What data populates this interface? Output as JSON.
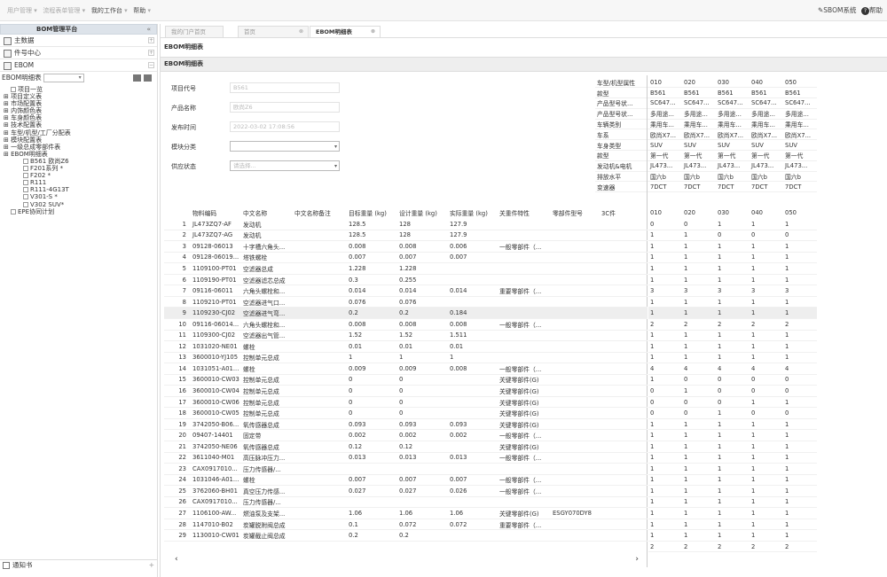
{
  "topbar": {
    "menus": [
      "用户管理",
      "流程表单管理",
      "我的工作台",
      "帮助"
    ],
    "system_label": "SBOM系统",
    "help_label": "帮助"
  },
  "sidebar": {
    "title": "BOM管理平台",
    "sections": [
      "主数据",
      "件号中心",
      "EBOM"
    ],
    "dropdown_value": "EBOM明细表",
    "tree": [
      {
        "label": "项目一览",
        "level": 1,
        "type": "item"
      },
      {
        "label": "项目定义表",
        "level": 0,
        "type": "folder"
      },
      {
        "label": "市场配置表",
        "level": 0,
        "type": "folder"
      },
      {
        "label": "内饰颜色表",
        "level": 0,
        "type": "folder"
      },
      {
        "label": "车身颜色表",
        "level": 0,
        "type": "folder"
      },
      {
        "label": "技术配置表",
        "level": 0,
        "type": "folder"
      },
      {
        "label": "车型/机型/工厂分配表",
        "level": 0,
        "type": "folder"
      },
      {
        "label": "模块配置表",
        "level": 0,
        "type": "folder"
      },
      {
        "label": "一级总成零部件表",
        "level": 0,
        "type": "folder"
      },
      {
        "label": "EBOM明细表",
        "level": 0,
        "type": "folder"
      },
      {
        "label": "B561 欧尚Z6",
        "level": 2,
        "type": "item"
      },
      {
        "label": "F201系列 *",
        "level": 2,
        "type": "item"
      },
      {
        "label": "F202 *",
        "level": 2,
        "type": "item"
      },
      {
        "label": "R111",
        "level": 2,
        "type": "item"
      },
      {
        "label": "R111-4G13T",
        "level": 2,
        "type": "item"
      },
      {
        "label": "V301-S *",
        "level": 2,
        "type": "item"
      },
      {
        "label": "V302 SUV*",
        "level": 2,
        "type": "item"
      },
      {
        "label": "EPE协同计划",
        "level": 1,
        "type": "item"
      }
    ],
    "footer": "通知书"
  },
  "tabs": [
    {
      "label": "我的门户首页",
      "active": false
    },
    {
      "label": "首页",
      "active": false
    },
    {
      "label": "EBOM明细表",
      "active": true
    }
  ],
  "breadcrumb": [
    "EBOM明细表",
    "EBOM明细表"
  ],
  "form": {
    "fields": [
      {
        "label": "项目代号",
        "value": "B561",
        "type": "text"
      },
      {
        "label": "产品名称",
        "value": "欧尚Z6",
        "type": "text"
      },
      {
        "label": "发布时间",
        "value": "2022-03-02 17:08:56",
        "type": "text"
      },
      {
        "label": "模块分类",
        "value": "",
        "type": "select"
      },
      {
        "label": "供应状态",
        "value": "请选择...",
        "type": "select"
      }
    ]
  },
  "attributes": {
    "labels": [
      "车型/机型属性",
      "款型",
      "产品型号状...",
      "产品型号状...",
      "车辆类别",
      "车系",
      "车身类型",
      "款型",
      "发动机&电机",
      "排放水平",
      "变速器"
    ],
    "columns": [
      {
        "code": "010",
        "values": [
          "B561",
          "SC647...",
          "多用途...",
          "乘用车...",
          "欧尚X7...",
          "SUV",
          "第一代",
          "JL473...",
          "国六b",
          "7DCT"
        ]
      },
      {
        "code": "020",
        "values": [
          "B561",
          "SC647...",
          "多用途...",
          "乘用车...",
          "欧尚X7...",
          "SUV",
          "第一代",
          "JL473...",
          "国六b",
          "7DCT"
        ]
      },
      {
        "code": "030",
        "values": [
          "B561",
          "SC647...",
          "多用途...",
          "乘用车...",
          "欧尚X7...",
          "SUV",
          "第一代",
          "JL473...",
          "国六b",
          "7DCT"
        ]
      },
      {
        "code": "040",
        "values": [
          "B561",
          "SC647...",
          "多用途...",
          "乘用车...",
          "欧尚X7...",
          "SUV",
          "第一代",
          "JL473...",
          "国六b",
          "7DCT"
        ]
      },
      {
        "code": "050",
        "values": [
          "B561",
          "SC647...",
          "多用途...",
          "乘用车...",
          "欧尚X7...",
          "SUV",
          "第一代",
          "JL473...",
          "国六b",
          "7DCT"
        ]
      }
    ]
  },
  "table": {
    "headers": [
      "",
      "物料编码",
      "中文名称",
      "中文名称备注",
      "目标重量 (kg)",
      "设计重量 (kg)",
      "实际重量 (kg)",
      "关重件特性",
      "零部件型号",
      "3C件"
    ],
    "rows": [
      [
        "1",
        "JL473ZQ7-AF",
        "发动机",
        "",
        "128.5",
        "128",
        "127.9",
        "",
        "",
        ""
      ],
      [
        "2",
        "JL473ZQ7-AG",
        "发动机",
        "",
        "128.5",
        "128",
        "127.9",
        "",
        "",
        ""
      ],
      [
        "3",
        "09128-06013",
        "十字槽六角头...",
        "",
        "0.008",
        "0.008",
        "0.006",
        "一般零部件（...",
        "",
        ""
      ],
      [
        "4",
        "09128-06019...",
        "塔铁螺栓",
        "",
        "0.007",
        "0.007",
        "0.007",
        "",
        "",
        ""
      ],
      [
        "5",
        "1109100-PT01",
        "空滤器总成",
        "",
        "1.228",
        "1.228",
        "",
        "",
        "",
        ""
      ],
      [
        "6",
        "1109190-PT01",
        "空滤器滤芯总成",
        "",
        "0.3",
        "0.255",
        "",
        "",
        "",
        ""
      ],
      [
        "7",
        "09116-06011",
        "六角头螺栓和...",
        "",
        "0.014",
        "0.014",
        "0.014",
        "重要零部件（...",
        "",
        ""
      ],
      [
        "8",
        "1109210-PT01",
        "空滤器进气口...",
        "",
        "0.076",
        "0.076",
        "",
        "",
        "",
        ""
      ],
      [
        "9",
        "1109230-CJ02",
        "空滤器进气弯...",
        "",
        "0.2",
        "0.2",
        "0.184",
        "",
        "",
        ""
      ],
      [
        "10",
        "09116-06014...",
        "六角头螺栓和...",
        "",
        "0.008",
        "0.008",
        "0.008",
        "一般零部件（...",
        "",
        ""
      ],
      [
        "11",
        "1109300-CJ02",
        "空滤器出气管...",
        "",
        "1.52",
        "1.52",
        "1.511",
        "",
        "",
        ""
      ],
      [
        "12",
        "1031020-NE01",
        "螺栓",
        "",
        "0.01",
        "0.01",
        "0.01",
        "",
        "",
        ""
      ],
      [
        "13",
        "3600010-YJ105",
        "控制单元总成",
        "",
        "1",
        "1",
        "1",
        "",
        "",
        ""
      ],
      [
        "14",
        "1031051-A01...",
        "螺栓",
        "",
        "0.009",
        "0.009",
        "0.008",
        "一般零部件（...",
        "",
        ""
      ],
      [
        "15",
        "3600010-CW03",
        "控制单元总成",
        "",
        "0",
        "0",
        "",
        "关键零部件(G)",
        "",
        ""
      ],
      [
        "16",
        "3600010-CW04",
        "控制单元总成",
        "",
        "0",
        "0",
        "",
        "关键零部件(G)",
        "",
        ""
      ],
      [
        "17",
        "3600010-CW06",
        "控制单元总成",
        "",
        "0",
        "0",
        "",
        "关键零部件(G)",
        "",
        ""
      ],
      [
        "18",
        "3600010-CW05",
        "控制单元总成",
        "",
        "0",
        "0",
        "",
        "关键零部件(G)",
        "",
        ""
      ],
      [
        "19",
        "3742050-B06...",
        "氧传感器总成",
        "",
        "0.093",
        "0.093",
        "0.093",
        "关键零部件(G)",
        "",
        ""
      ],
      [
        "20",
        "09407-14401",
        "固定带",
        "",
        "0.002",
        "0.002",
        "0.002",
        "一般零部件（...",
        "",
        ""
      ],
      [
        "21",
        "3742050-NE06",
        "氧传感器总成",
        "",
        "0.12",
        "0.12",
        "",
        "关键零部件(G)",
        "",
        ""
      ],
      [
        "22",
        "3611040-M01",
        "高压脉冲压力...",
        "",
        "0.013",
        "0.013",
        "0.013",
        "一般零部件（...",
        "",
        ""
      ],
      [
        "23",
        "CAX0917010...",
        "压力传感器/...",
        "",
        "",
        "",
        "",
        "",
        "",
        ""
      ],
      [
        "24",
        "1031046-A01...",
        "螺栓",
        "",
        "0.007",
        "0.007",
        "0.007",
        "一般零部件（...",
        "",
        ""
      ],
      [
        "25",
        "3762060-BH01",
        "真空压力传感...",
        "",
        "0.027",
        "0.027",
        "0.026",
        "一般零部件（...",
        "",
        ""
      ],
      [
        "26",
        "CAX0917010...",
        "压力传感器/...",
        "",
        "",
        "",
        "",
        "",
        "",
        ""
      ],
      [
        "27",
        "1106100-AW...",
        "燃油泵及支架...",
        "",
        "1.06",
        "1.06",
        "1.06",
        "关键零部件(G)",
        "ESGY070DY8",
        ""
      ],
      [
        "28",
        "1147010-B02",
        "炭罐脱附阀总成",
        "",
        "0.1",
        "0.072",
        "0.072",
        "重要零部件（...",
        "",
        ""
      ],
      [
        "29",
        "1130010-CW01",
        "炭罐截止阀总成",
        "",
        "0.2",
        "0.2",
        "",
        "",
        "",
        ""
      ]
    ]
  },
  "right_table": {
    "headers": [
      "010",
      "020",
      "030",
      "040",
      "050"
    ],
    "rows": [
      [
        "0",
        "0",
        "1",
        "1",
        "1"
      ],
      [
        "1",
        "1",
        "0",
        "0",
        "0"
      ],
      [
        "1",
        "1",
        "1",
        "1",
        "1"
      ],
      [
        "1",
        "1",
        "1",
        "1",
        "1"
      ],
      [
        "1",
        "1",
        "1",
        "1",
        "1"
      ],
      [
        "1",
        "1",
        "1",
        "1",
        "1"
      ],
      [
        "3",
        "3",
        "3",
        "3",
        "3"
      ],
      [
        "1",
        "1",
        "1",
        "1",
        "1"
      ],
      [
        "1",
        "1",
        "1",
        "1",
        "1"
      ],
      [
        "2",
        "2",
        "2",
        "2",
        "2"
      ],
      [
        "1",
        "1",
        "1",
        "1",
        "1"
      ],
      [
        "1",
        "1",
        "1",
        "1",
        "1"
      ],
      [
        "1",
        "1",
        "1",
        "1",
        "1"
      ],
      [
        "4",
        "4",
        "4",
        "4",
        "4"
      ],
      [
        "1",
        "0",
        "0",
        "0",
        "0"
      ],
      [
        "0",
        "1",
        "0",
        "0",
        "0"
      ],
      [
        "0",
        "0",
        "0",
        "1",
        "1"
      ],
      [
        "0",
        "0",
        "1",
        "0",
        "0"
      ],
      [
        "1",
        "1",
        "1",
        "1",
        "1"
      ],
      [
        "1",
        "1",
        "1",
        "1",
        "1"
      ],
      [
        "1",
        "1",
        "1",
        "1",
        "1"
      ],
      [
        "1",
        "1",
        "1",
        "1",
        "1"
      ],
      [
        "1",
        "1",
        "1",
        "1",
        "1"
      ],
      [
        "1",
        "1",
        "1",
        "1",
        "1"
      ],
      [
        "1",
        "1",
        "1",
        "1",
        "1"
      ],
      [
        "1",
        "1",
        "1",
        "1",
        "1"
      ],
      [
        "1",
        "1",
        "1",
        "1",
        "1"
      ],
      [
        "1",
        "1",
        "1",
        "1",
        "1"
      ],
      [
        "1",
        "1",
        "1",
        "1",
        "1"
      ],
      [
        "2",
        "2",
        "2",
        "2",
        "2"
      ]
    ]
  }
}
